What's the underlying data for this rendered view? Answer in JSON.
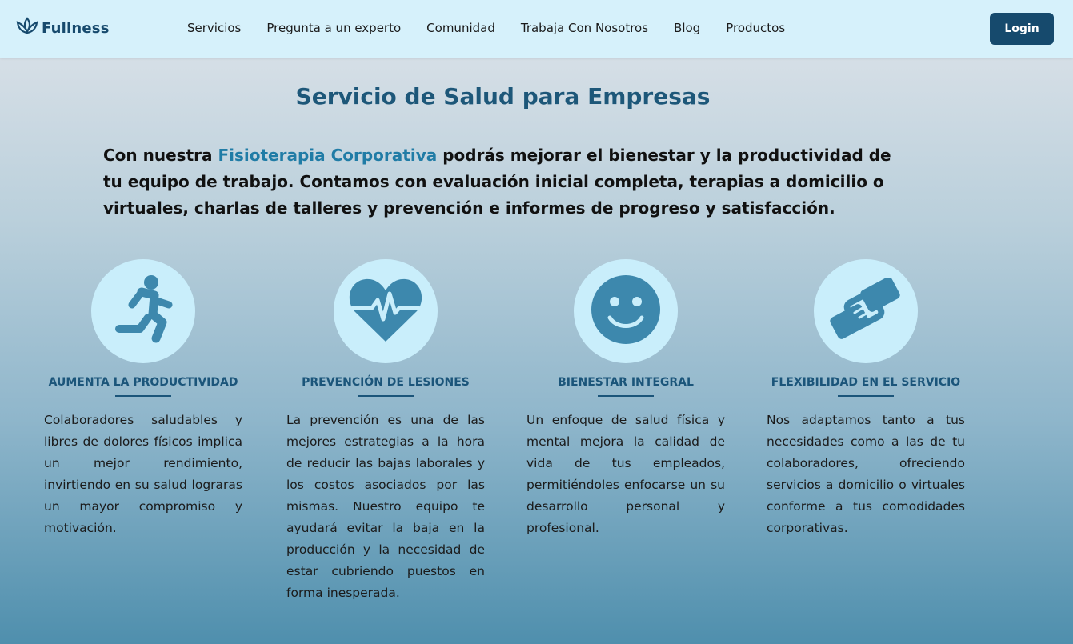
{
  "brand": {
    "name": "Fullness",
    "logo_icon": "lotus-icon"
  },
  "nav": {
    "items": [
      "Servicios",
      "Pregunta a un experto",
      "Comunidad",
      "Trabaja Con Nosotros",
      "Blog",
      "Productos"
    ],
    "login_label": "Login"
  },
  "page": {
    "title": "Servicio de Salud para Empresas",
    "intro_before": "Con nuestra ",
    "intro_highlight": "Fisioterapia Corporativa",
    "intro_after": " podrás mejorar el bienestar y la productividad de tu equipo de trabajo. Contamos con evaluación inicial completa, terapias a domicilio o virtuales, charlas de talleres y prevención e informes de progreso y satisfacción."
  },
  "features": [
    {
      "icon": "running-person-icon",
      "title": "AUMENTA LA PRODUCTIVIDAD",
      "text": "Colaboradores saludables y libres de dolores físicos implica un mejor rendimiento, invirtiendo en su salud lograras un mayor compromiso y motivación."
    },
    {
      "icon": "heart-pulse-icon",
      "title": "PREVENCIÓN DE LESIONES",
      "text": "La prevención es una de las mejores estrategias a la hora de reducir las bajas laborales y los costos asociados por las mismas. Nuestro equipo te ayudará evitar la baja en la producción y la necesidad de estar cubriendo puestos en forma inesperada."
    },
    {
      "icon": "smiley-face-icon",
      "title": "BIENESTAR INTEGRAL",
      "text": "Un enfoque de salud física y mental mejora la calidad de vida de tus empleados, permitiéndoles enfocarse un su desarrollo personal y profesional."
    },
    {
      "icon": "handshake-icon",
      "title": "FLEXIBILIDAD EN EL SERVICIO",
      "text": "Nos adaptamos tanto a tus necesidades como a las de tu colaboradores, ofreciendo servicios a domicilio o virtuales conforme a tus comodidades corporativas."
    }
  ],
  "colors": {
    "accent": "#164a6d",
    "icon": "#3d88ad",
    "circle": "#c9eefb",
    "highlight": "#207ca6"
  }
}
